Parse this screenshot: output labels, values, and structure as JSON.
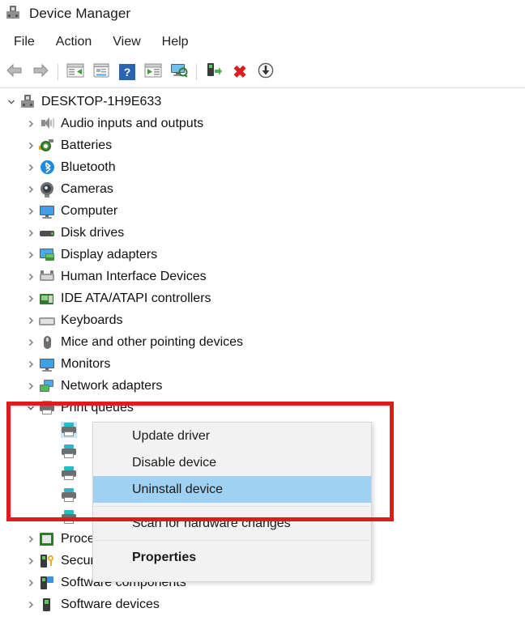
{
  "window": {
    "title": "Device Manager",
    "icon": "device-manager-icon"
  },
  "menubar": {
    "items": [
      {
        "label": "File"
      },
      {
        "label": "Action"
      },
      {
        "label": "View"
      },
      {
        "label": "Help"
      }
    ]
  },
  "toolbar": {
    "buttons": [
      {
        "name": "back-button",
        "icon": "back-arrow-icon"
      },
      {
        "name": "forward-button",
        "icon": "forward-arrow-icon"
      },
      {
        "name": "separator-1",
        "icon": "separator"
      },
      {
        "name": "show-hide-console-tree-button",
        "icon": "console-tree-icon"
      },
      {
        "name": "properties-button",
        "icon": "properties-icon"
      },
      {
        "name": "help-button",
        "icon": "help-question-icon"
      },
      {
        "name": "show-hide-action-pane-button",
        "icon": "action-pane-icon"
      },
      {
        "name": "scan-for-hardware-changes-button",
        "icon": "scan-monitor-icon"
      },
      {
        "name": "separator-2",
        "icon": "separator"
      },
      {
        "name": "update-driver-button",
        "icon": "update-driver-icon"
      },
      {
        "name": "uninstall-device-button",
        "icon": "red-x-icon"
      },
      {
        "name": "disable-device-button",
        "icon": "download-circle-icon"
      }
    ]
  },
  "tree": {
    "root": {
      "label": "DESKTOP-1H9E633",
      "icon": "computer-icon",
      "expanded": true
    },
    "nodes": [
      {
        "label": "Audio inputs and outputs",
        "icon": "speaker-icon",
        "expanded": false
      },
      {
        "label": "Batteries",
        "icon": "battery-icon",
        "expanded": false
      },
      {
        "label": "Bluetooth",
        "icon": "bluetooth-icon",
        "expanded": false
      },
      {
        "label": "Cameras",
        "icon": "camera-icon",
        "expanded": false
      },
      {
        "label": "Computer",
        "icon": "monitor-icon",
        "expanded": false
      },
      {
        "label": "Disk drives",
        "icon": "disk-drive-icon",
        "expanded": false
      },
      {
        "label": "Display adapters",
        "icon": "display-adapter-icon",
        "expanded": false
      },
      {
        "label": "Human Interface Devices",
        "icon": "hid-icon",
        "expanded": false
      },
      {
        "label": "IDE ATA/ATAPI controllers",
        "icon": "ide-controller-icon",
        "expanded": false
      },
      {
        "label": "Keyboards",
        "icon": "keyboard-icon",
        "expanded": false
      },
      {
        "label": "Mice and other pointing devices",
        "icon": "mouse-icon",
        "expanded": false
      },
      {
        "label": "Monitors",
        "icon": "monitor-icon",
        "expanded": false
      },
      {
        "label": "Network adapters",
        "icon": "network-adapter-icon",
        "expanded": false
      },
      {
        "label": "Print queues",
        "icon": "printer-icon",
        "expanded": true
      },
      {
        "label": "",
        "icon": "printer-icon",
        "child": true,
        "selected": true
      },
      {
        "label": "",
        "icon": "printer-icon",
        "child": true
      },
      {
        "label": "",
        "icon": "printer-icon",
        "child": true
      },
      {
        "label": "",
        "icon": "printer-icon",
        "child": true
      },
      {
        "label": "",
        "icon": "printer-icon",
        "child": true
      },
      {
        "label": "Processors",
        "icon": "processor-icon",
        "expanded": false
      },
      {
        "label": "Security devices",
        "icon": "security-device-icon",
        "expanded": false
      },
      {
        "label": "Software components",
        "icon": "software-component-icon",
        "expanded": false
      },
      {
        "label": "Software devices",
        "icon": "software-device-icon",
        "expanded": false
      }
    ]
  },
  "context_menu": {
    "items": [
      {
        "label": "Update driver",
        "highlighted": false,
        "bold": false
      },
      {
        "label": "Disable device",
        "highlighted": false,
        "bold": false
      },
      {
        "label": "Uninstall device",
        "highlighted": true,
        "bold": false
      },
      {
        "separator": true
      },
      {
        "label": "Scan for hardware changes",
        "highlighted": false,
        "bold": false
      },
      {
        "separator": true
      },
      {
        "label": "Properties",
        "highlighted": false,
        "bold": true
      }
    ]
  },
  "annotation": {
    "highlight_box_color": "#e01b1b"
  },
  "colors": {
    "menu_highlight": "#9fd1f2",
    "menu_background": "#f2f2f2",
    "tree_selection": "#cce4f7",
    "accent_blue": "#2a62b5"
  }
}
